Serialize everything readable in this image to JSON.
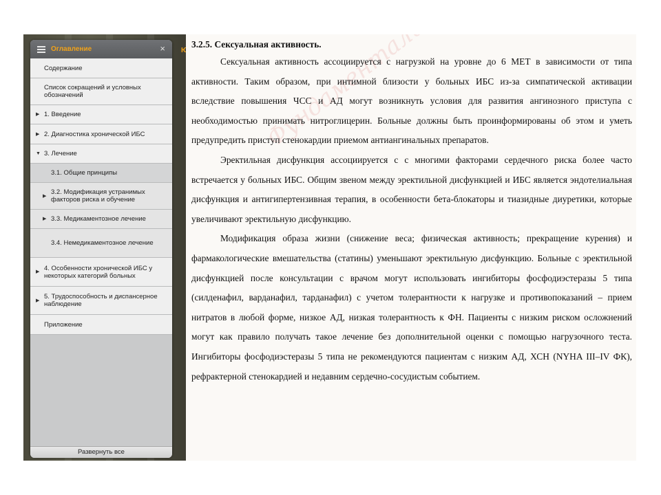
{
  "sidebar": {
    "title": "Оглавление",
    "close_icon": "×",
    "tab_marker": "Ю",
    "expand_all_label": "Развернуть все",
    "items": [
      {
        "label": "Содержание",
        "level": 0,
        "expandable": false
      },
      {
        "label": "Список сокращений и условных обозначений",
        "level": 0,
        "expandable": false
      },
      {
        "label": "1. Введение",
        "level": 0,
        "expandable": true
      },
      {
        "label": "2. Диагностика хронической ИБС",
        "level": 0,
        "expandable": true
      },
      {
        "label": "3. Лечение",
        "level": 0,
        "expandable": true,
        "expanded": true
      },
      {
        "label": "3.1. Общие принципы",
        "level": 1,
        "expandable": false
      },
      {
        "label": "3.2. Модификация устранимых факторов риска и обучение",
        "level": 1,
        "expandable": true
      },
      {
        "label": "3.3. Медикаментозное лечение",
        "level": 1,
        "expandable": true
      },
      {
        "label": "3.4. Немедикаментозное лечение",
        "level": 1,
        "expandable": false
      },
      {
        "label": "4. Особенности хронической ИБС у некоторых категорий больных",
        "level": 0,
        "expandable": true
      },
      {
        "label": "5. Трудоспособность и диспансерное наблюдение",
        "level": 0,
        "expandable": true
      },
      {
        "label": "Приложение",
        "level": 0,
        "expandable": false
      }
    ]
  },
  "document": {
    "heading": "3.2.5. Сексуальная активность.",
    "paragraphs": [
      "Сексуальная активность ассоциируется с нагрузкой на уровне до 6 МЕТ в зависимости от типа активности. Таким образом, при интимной близости у больных ИБС из-за симпатической активации вследствие повышения ЧСС и АД могут возникнуть условия для развития ангинозного приступа с необходимостью принимать нитроглицерин. Больные должны быть проинформированы об этом и уметь предупредить приступ стенокардии приемом антиангинальных препаратов.",
      "Эректильная дисфункция ассоциируется с с многими факторами сердечного риска более часто встречается у больных ИБС. Общим звеном между эректильной дисфункцией и ИБС является эндотелиальная дисфункция и антигипертензивная терапия, в особенности бета-блокаторы и тиазидные диуретики, которые увеличивают эректильную дисфункцию.",
      "Модификация образа жизни (снижение веса; физическая активность; прекращение курения) и фармакологические вмешательства (статины) уменьшают эректильную дисфункцию. Больные с эректильной дисфункцией после консультации с врачом могут использовать ингибиторы фосфодиэстеразы 5 типа (силденафил, варданафил, тарданафил) с учетом толерантности к нагрузке и противопоказаний – прием нитратов в любой форме, низкое АД, низкая толерантность к ФН. Пациенты с низким риском осложнений могут как правило получать такое лечение без дополнительной оценки с помощью нагрузочного теста. Ингибиторы фосфодиэстеразы 5 типа не рекомендуются пациентам с низким АД, ХСН (NYHA III–IV ФК), рефрактерной стенокардией и недавним сердечно-сосудистым событием."
    ],
    "watermark": "Фундаментальная электронная библиотека"
  }
}
